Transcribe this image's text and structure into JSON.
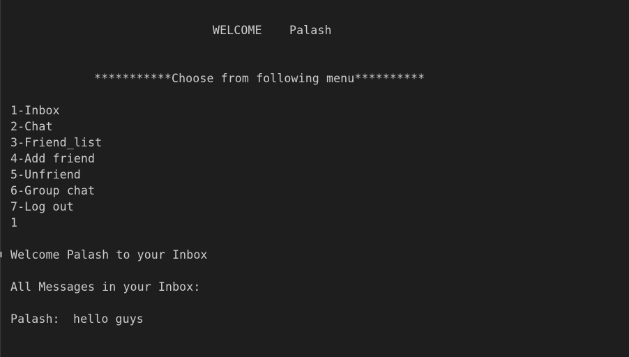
{
  "welcome": {
    "label": "WELCOME",
    "username": "Palash"
  },
  "menu": {
    "header": "***********Choose from following menu**********",
    "items": [
      "1-Inbox",
      "2-Chat",
      "3-Friend_list",
      "4-Add friend",
      "5-Unfriend",
      "6-Group chat",
      "7-Log out"
    ],
    "user_input": "1"
  },
  "inbox": {
    "greeting": "Welcome Palash to your Inbox",
    "heading": "All Messages in your Inbox:",
    "messages": [
      {
        "sender": "Palash:",
        "text": "hello guys"
      }
    ]
  }
}
